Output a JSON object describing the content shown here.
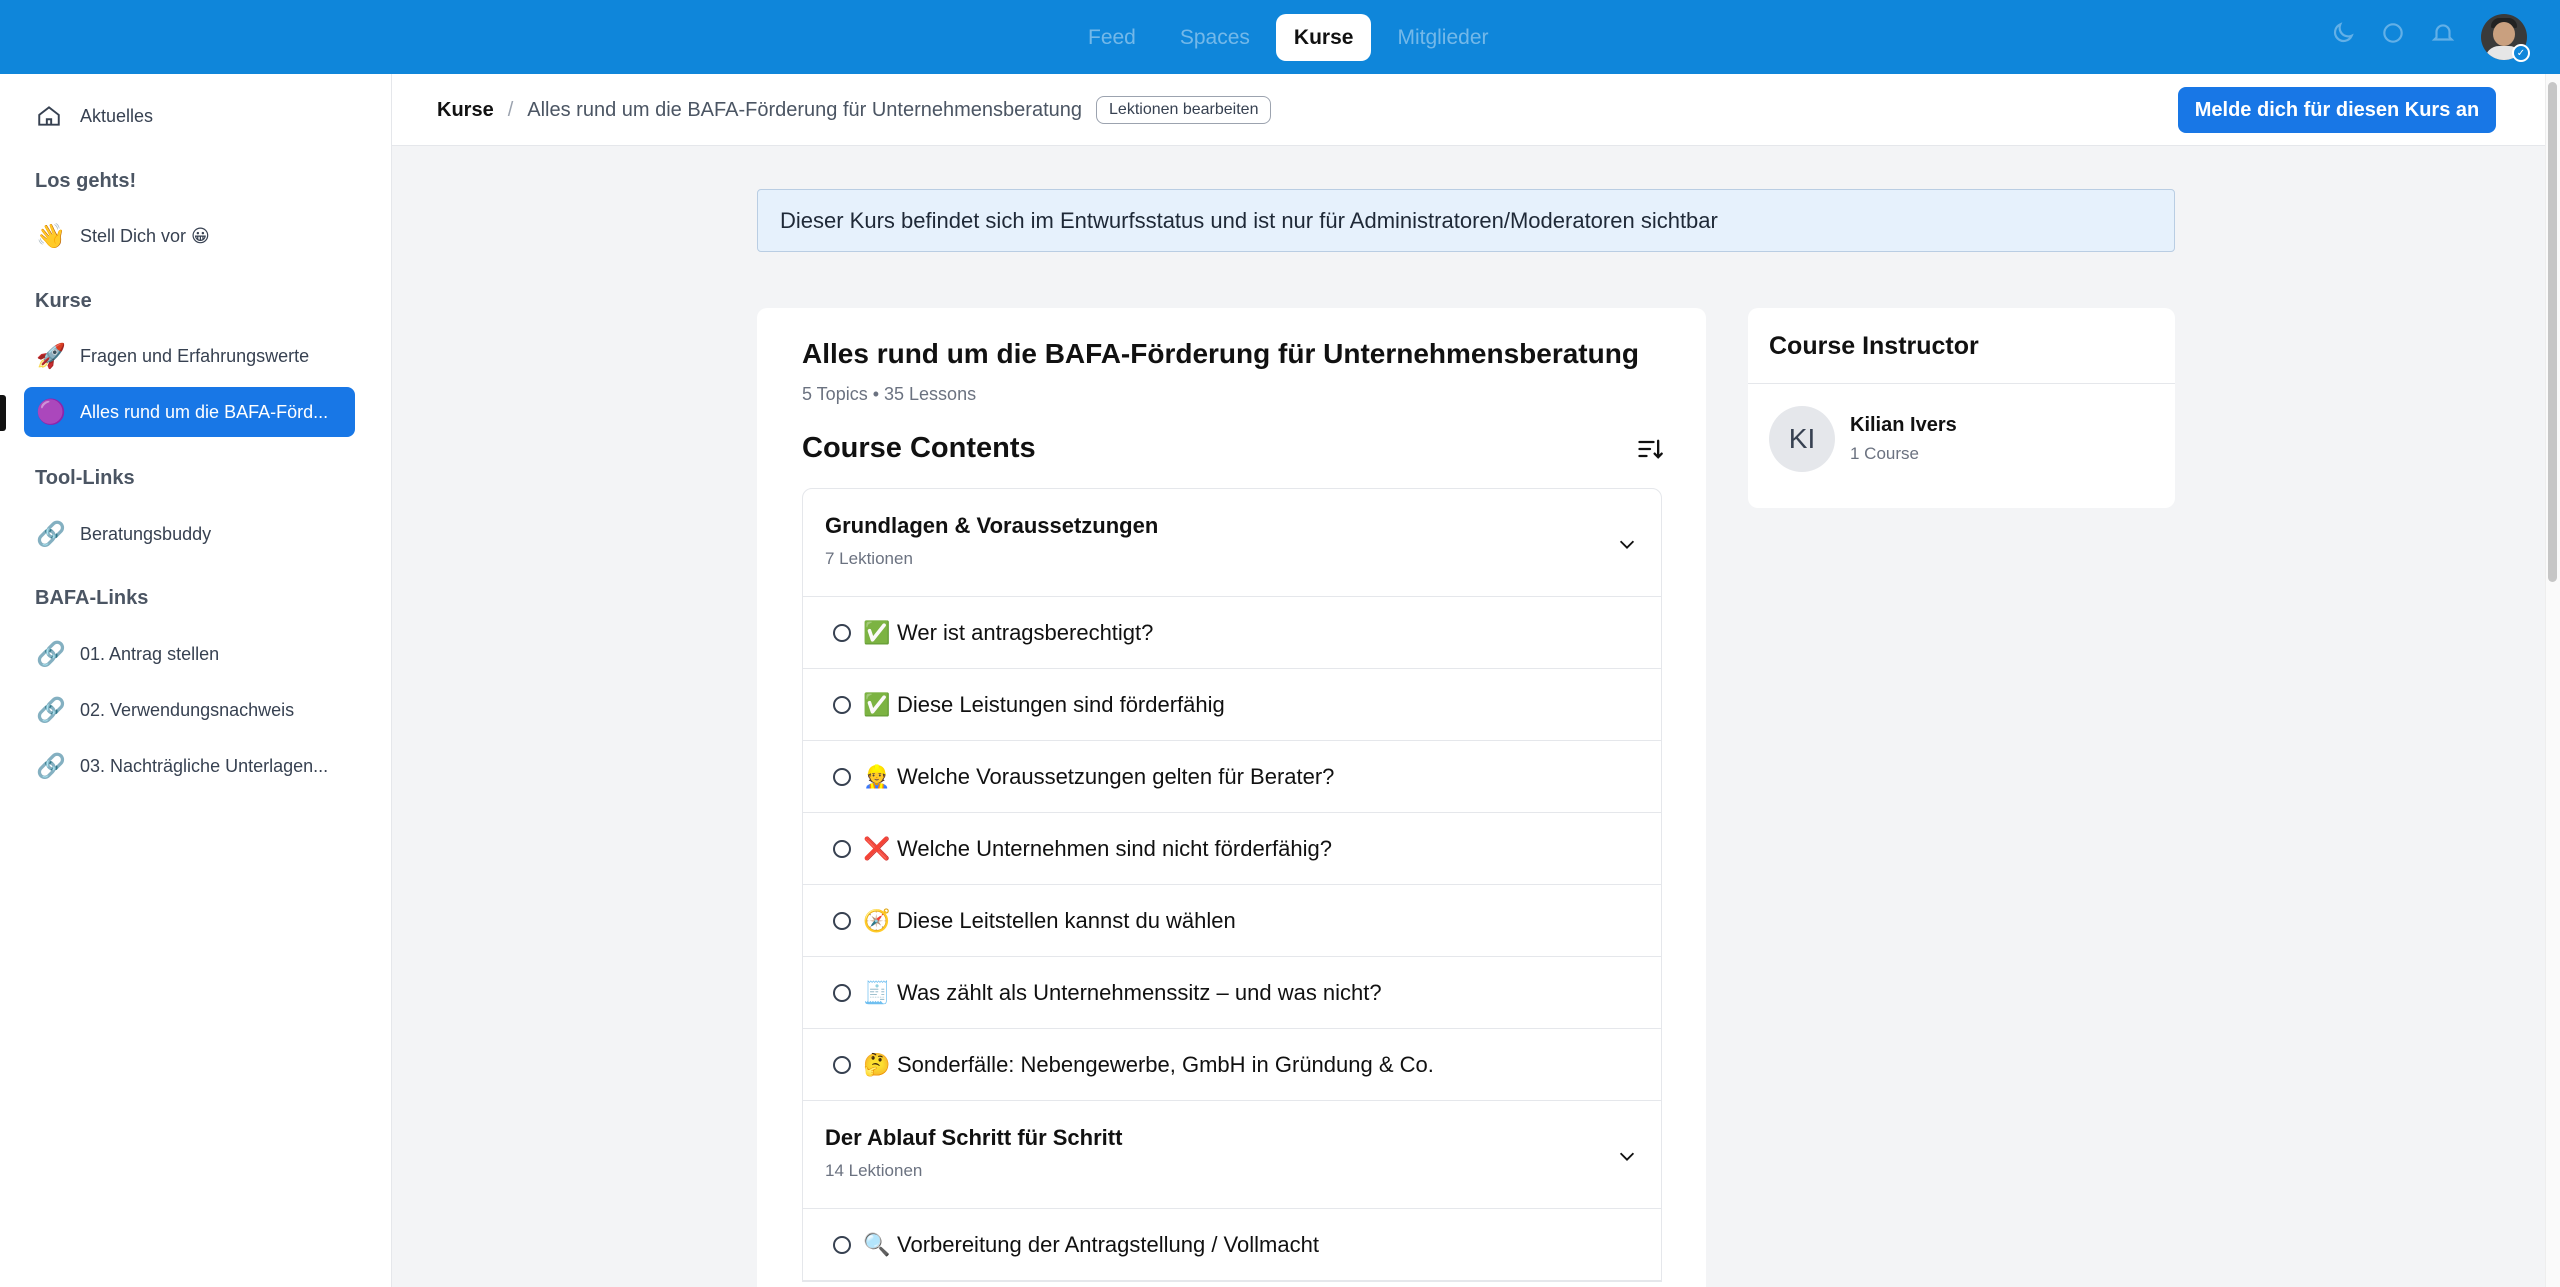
{
  "topnav": {
    "tabs": [
      {
        "label": "Feed",
        "active": false
      },
      {
        "label": "Spaces",
        "active": false
      },
      {
        "label": "Kurse",
        "active": true
      },
      {
        "label": "Mitglieder",
        "active": false
      }
    ]
  },
  "top_icons": [
    "moon-icon",
    "chat-icon",
    "bell-icon"
  ],
  "sidebar": {
    "home": {
      "label": "Aktuelles",
      "icon": "home-icon"
    },
    "sections": [
      {
        "heading": "Los gehts!",
        "items": [
          {
            "label": "Stell Dich vor 😀",
            "icon": "👋"
          }
        ]
      },
      {
        "heading": "Kurse",
        "items": [
          {
            "label": "Fragen und Erfahrungswerte",
            "icon": "🚀"
          },
          {
            "label": "Alles rund um die BAFA-Förd...",
            "icon": "🟣",
            "active": true
          }
        ]
      },
      {
        "heading": "Tool-Links",
        "items": [
          {
            "label": "Beratungsbuddy",
            "icon": "link-icon"
          }
        ]
      },
      {
        "heading": "BAFA-Links",
        "items": [
          {
            "label": "01. Antrag stellen",
            "icon": "link-icon"
          },
          {
            "label": "02. Verwendungsnachweis",
            "icon": "link-icon"
          },
          {
            "label": "03. Nachträgliche Unterlagen...",
            "icon": "link-icon"
          }
        ]
      }
    ]
  },
  "breadcrumb": {
    "root": "Kurse",
    "separator": "/",
    "current": "Alles rund um die BAFA-Förderung für Unternehmensberatung",
    "edit_label": "Lektionen bearbeiten"
  },
  "enroll_button": "Melde dich für diesen Kurs an",
  "notice": "Dieser Kurs befindet sich im Entwurfsstatus und ist nur für Administratoren/Moderatoren sichtbar",
  "course": {
    "title": "Alles rund um die BAFA-Förderung für Unternehmensberatung",
    "meta": "5 Topics • 35 Lessons",
    "contents_title": "Course Contents",
    "topics": [
      {
        "title": "Grundlagen & Voraussetzungen",
        "subtitle": "7 Lektionen",
        "lessons": [
          {
            "emoji": "✅",
            "title": "Wer ist antragsberechtigt?"
          },
          {
            "emoji": "✅",
            "title": "Diese Leistungen sind förderfähig"
          },
          {
            "emoji": "👷",
            "title": "Welche Voraussetzungen gelten für Berater?"
          },
          {
            "emoji": "❌",
            "title": "Welche Unternehmen sind nicht förderfähig?"
          },
          {
            "emoji": "🧭",
            "title": "Diese Leitstellen kannst du wählen"
          },
          {
            "emoji": "🧾",
            "title": "Was zählt als Unternehmenssitz – und was nicht?"
          },
          {
            "emoji": "🤔",
            "title": "Sonderfälle: Nebengewerbe, GmbH in Gründung & Co."
          }
        ]
      },
      {
        "title": "Der Ablauf Schritt für Schritt",
        "subtitle": "14 Lektionen",
        "lessons": [
          {
            "emoji": "🔍",
            "title": "Vorbereitung der Antragstellung / Vollmacht"
          }
        ]
      }
    ]
  },
  "instructor": {
    "heading": "Course Instructor",
    "initials": "KI",
    "name": "Kilian Ivers",
    "courses": "1 Course"
  },
  "colors": {
    "brand_blue": "#0f86da",
    "accent_blue": "#1877e6",
    "notice_bg": "#e6f1fc"
  }
}
